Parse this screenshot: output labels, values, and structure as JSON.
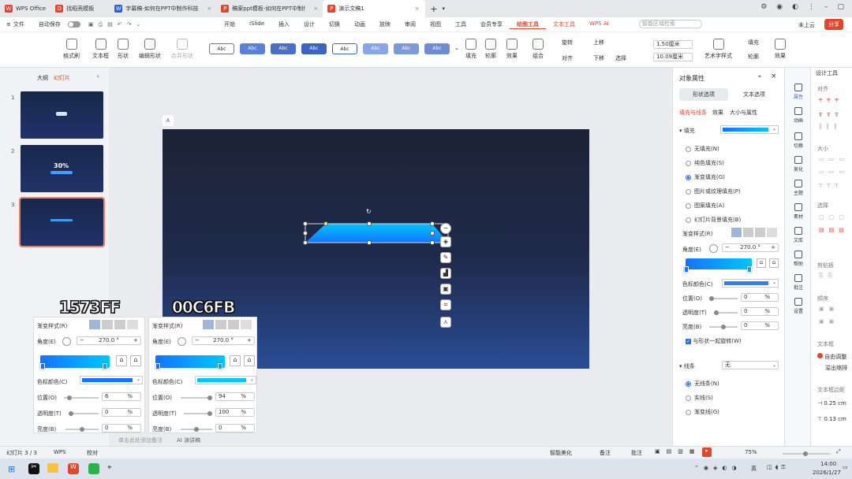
{
  "tabs": [
    {
      "label": "WPS Office",
      "icon": "wps-icon",
      "color": "#e2452c"
    },
    {
      "label": "找稻壳模板",
      "icon": "docer-icon",
      "color": "#e2452c"
    },
    {
      "label": "字幕稿-如何在PPT中制作科技感",
      "icon": "word-icon",
      "color": "#2b5fd9"
    },
    {
      "label": "稿案ppt模板-如何在PPT中制作",
      "icon": "ppt-icon",
      "color": "#e2452c"
    },
    {
      "label": "演示文稿1",
      "icon": "ppt-icon",
      "color": "#e2452c"
    }
  ],
  "menu": {
    "file": "文件",
    "autosave": "自动保存",
    "items": [
      "开始",
      "iSlide",
      "插入",
      "设计",
      "切换",
      "动画",
      "放映",
      "审阅",
      "视图",
      "工具",
      "会员专享",
      "绘图工具",
      "文本工具",
      "WPS AI"
    ],
    "active": "绘图工具",
    "search_placeholder": "智能区域检索",
    "unsynced": "未上云",
    "share": "分享"
  },
  "ribbon": {
    "left": [
      "格式刷",
      "文本框",
      "形状",
      "编辑形状",
      "合并形状"
    ],
    "styles": [
      "Abc",
      "Abc",
      "Abc",
      "Abc",
      "Abc",
      "Abc",
      "Abc",
      "Abc"
    ],
    "right_a": [
      "填充",
      "轮廓",
      "效果"
    ],
    "right_b": [
      "组合",
      "对齐",
      "旋转",
      "下移",
      "上移",
      "选择"
    ],
    "width": "1.50厘米",
    "height": "10.09厘米",
    "right_c": [
      "艺术字样式",
      "填充",
      "轮廓",
      "效果"
    ]
  },
  "leftpane": {
    "tab_outline": "大纲",
    "tab_slides": "幻灯片",
    "slides": [
      "1",
      "2",
      "3"
    ],
    "slide2_text": "30%"
  },
  "overlays": {
    "left": {
      "hex": "1573FF",
      "title": "渐变样式(R)",
      "angle_label": "角度(E)",
      "angle": "270.0",
      "deg": "°",
      "color_label": "色标颜色(C)",
      "color": "#1573ff",
      "pos_label": "位置(O)",
      "pos": "6",
      "trans_label": "透明度(T)",
      "trans": "0",
      "bright_label": "亮度(B)",
      "bright": "0",
      "pct": "%"
    },
    "right": {
      "hex": "00C6FB",
      "title": "渐变样式(R)",
      "angle_label": "角度(E)",
      "angle": "270.0",
      "deg": "°",
      "color_label": "色标颜色(C)",
      "color": "#00c6fb",
      "pos_label": "位置(O)",
      "pos": "94",
      "trans_label": "透明度(T)",
      "trans": "100",
      "bright_label": "亮度(B)",
      "bright": "0",
      "pct": "%"
    }
  },
  "notes_placeholder": "单击此处添加备注",
  "ai_notes": "AI 演讲稿",
  "rightpane": {
    "title": "对象属性",
    "tab_shape": "形状选项",
    "tab_text": "文本选项",
    "subtabs": [
      "填充与线条",
      "效果",
      "大小与属性"
    ],
    "fill": "填充",
    "fill_options": [
      "无填充(N)",
      "纯色填充(S)",
      "渐变填充(G)",
      "图片或纹理填充(P)",
      "图案填充(A)",
      "幻灯片背景填充(B)"
    ],
    "fill_selected": 2,
    "grad_style": "渐变样式(R)",
    "angle_label": "角度(E)",
    "angle": "270.0",
    "deg": "°",
    "color_label": "色标颜色(C)",
    "color": "#2f80f0",
    "pos_label": "位置(O)",
    "pos": "0",
    "trans_label": "透明度(T)",
    "trans": "0",
    "bright_label": "亮度(B)",
    "bright": "0",
    "pct": "%",
    "rotate_with": "与形状一起旋转(W)",
    "line": "线条",
    "line_value": "无",
    "line_options": [
      "无线条(N)",
      "实线(S)",
      "渐变线(G)"
    ]
  },
  "iconstrip": [
    "属性",
    "动画",
    "切换",
    "美化",
    "主题",
    "素材",
    "文库",
    "帮助",
    "批注",
    "设置"
  ],
  "designpane": {
    "title": "设计工具",
    "align": "对齐",
    "size": "大小",
    "select": "选择",
    "clipboard": "剪贴板",
    "order": "顺序",
    "textbox": "文本框",
    "autofit": "自由调整",
    "overflow": "溢出缩排",
    "margin": "文本框边距",
    "m1": "0.25 cm",
    "m2": "0.13 cm"
  },
  "status": {
    "slide": "幻灯片 3 / 3",
    "wps": "WPS",
    "proof": "校对",
    "beautify": "智能美化",
    "notes": "备注",
    "comment": "批注",
    "zoom": "75%"
  },
  "taskbar": {
    "time": "14:00",
    "date": "2026/1/27",
    "lang": "英"
  }
}
